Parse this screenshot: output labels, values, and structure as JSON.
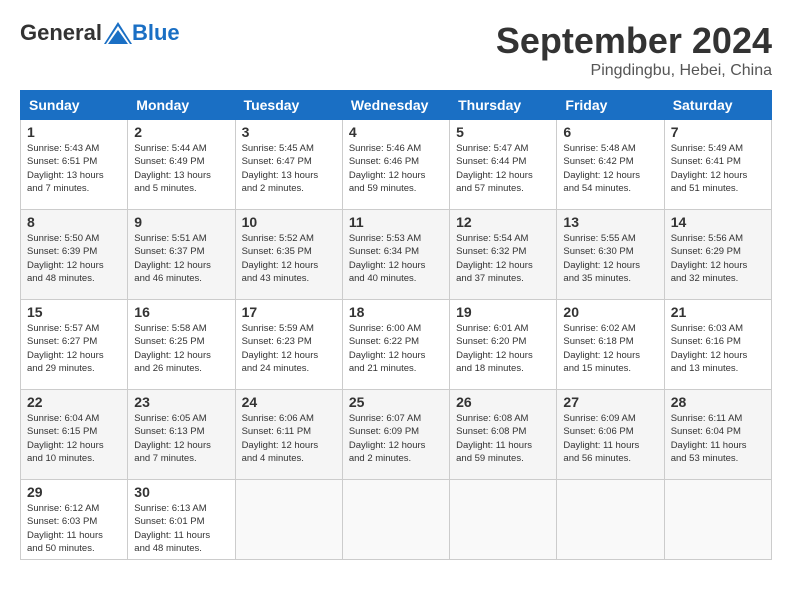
{
  "header": {
    "logo_general": "General",
    "logo_blue": "Blue",
    "month_title": "September 2024",
    "location": "Pingdingbu, Hebei, China"
  },
  "weekdays": [
    "Sunday",
    "Monday",
    "Tuesday",
    "Wednesday",
    "Thursday",
    "Friday",
    "Saturday"
  ],
  "weeks": [
    [
      {
        "day": "1",
        "info": "Sunrise: 5:43 AM\nSunset: 6:51 PM\nDaylight: 13 hours\nand 7 minutes."
      },
      {
        "day": "2",
        "info": "Sunrise: 5:44 AM\nSunset: 6:49 PM\nDaylight: 13 hours\nand 5 minutes."
      },
      {
        "day": "3",
        "info": "Sunrise: 5:45 AM\nSunset: 6:47 PM\nDaylight: 13 hours\nand 2 minutes."
      },
      {
        "day": "4",
        "info": "Sunrise: 5:46 AM\nSunset: 6:46 PM\nDaylight: 12 hours\nand 59 minutes."
      },
      {
        "day": "5",
        "info": "Sunrise: 5:47 AM\nSunset: 6:44 PM\nDaylight: 12 hours\nand 57 minutes."
      },
      {
        "day": "6",
        "info": "Sunrise: 5:48 AM\nSunset: 6:42 PM\nDaylight: 12 hours\nand 54 minutes."
      },
      {
        "day": "7",
        "info": "Sunrise: 5:49 AM\nSunset: 6:41 PM\nDaylight: 12 hours\nand 51 minutes."
      }
    ],
    [
      {
        "day": "8",
        "info": "Sunrise: 5:50 AM\nSunset: 6:39 PM\nDaylight: 12 hours\nand 48 minutes."
      },
      {
        "day": "9",
        "info": "Sunrise: 5:51 AM\nSunset: 6:37 PM\nDaylight: 12 hours\nand 46 minutes."
      },
      {
        "day": "10",
        "info": "Sunrise: 5:52 AM\nSunset: 6:35 PM\nDaylight: 12 hours\nand 43 minutes."
      },
      {
        "day": "11",
        "info": "Sunrise: 5:53 AM\nSunset: 6:34 PM\nDaylight: 12 hours\nand 40 minutes."
      },
      {
        "day": "12",
        "info": "Sunrise: 5:54 AM\nSunset: 6:32 PM\nDaylight: 12 hours\nand 37 minutes."
      },
      {
        "day": "13",
        "info": "Sunrise: 5:55 AM\nSunset: 6:30 PM\nDaylight: 12 hours\nand 35 minutes."
      },
      {
        "day": "14",
        "info": "Sunrise: 5:56 AM\nSunset: 6:29 PM\nDaylight: 12 hours\nand 32 minutes."
      }
    ],
    [
      {
        "day": "15",
        "info": "Sunrise: 5:57 AM\nSunset: 6:27 PM\nDaylight: 12 hours\nand 29 minutes."
      },
      {
        "day": "16",
        "info": "Sunrise: 5:58 AM\nSunset: 6:25 PM\nDaylight: 12 hours\nand 26 minutes."
      },
      {
        "day": "17",
        "info": "Sunrise: 5:59 AM\nSunset: 6:23 PM\nDaylight: 12 hours\nand 24 minutes."
      },
      {
        "day": "18",
        "info": "Sunrise: 6:00 AM\nSunset: 6:22 PM\nDaylight: 12 hours\nand 21 minutes."
      },
      {
        "day": "19",
        "info": "Sunrise: 6:01 AM\nSunset: 6:20 PM\nDaylight: 12 hours\nand 18 minutes."
      },
      {
        "day": "20",
        "info": "Sunrise: 6:02 AM\nSunset: 6:18 PM\nDaylight: 12 hours\nand 15 minutes."
      },
      {
        "day": "21",
        "info": "Sunrise: 6:03 AM\nSunset: 6:16 PM\nDaylight: 12 hours\nand 13 minutes."
      }
    ],
    [
      {
        "day": "22",
        "info": "Sunrise: 6:04 AM\nSunset: 6:15 PM\nDaylight: 12 hours\nand 10 minutes."
      },
      {
        "day": "23",
        "info": "Sunrise: 6:05 AM\nSunset: 6:13 PM\nDaylight: 12 hours\nand 7 minutes."
      },
      {
        "day": "24",
        "info": "Sunrise: 6:06 AM\nSunset: 6:11 PM\nDaylight: 12 hours\nand 4 minutes."
      },
      {
        "day": "25",
        "info": "Sunrise: 6:07 AM\nSunset: 6:09 PM\nDaylight: 12 hours\nand 2 minutes."
      },
      {
        "day": "26",
        "info": "Sunrise: 6:08 AM\nSunset: 6:08 PM\nDaylight: 11 hours\nand 59 minutes."
      },
      {
        "day": "27",
        "info": "Sunrise: 6:09 AM\nSunset: 6:06 PM\nDaylight: 11 hours\nand 56 minutes."
      },
      {
        "day": "28",
        "info": "Sunrise: 6:11 AM\nSunset: 6:04 PM\nDaylight: 11 hours\nand 53 minutes."
      }
    ],
    [
      {
        "day": "29",
        "info": "Sunrise: 6:12 AM\nSunset: 6:03 PM\nDaylight: 11 hours\nand 50 minutes."
      },
      {
        "day": "30",
        "info": "Sunrise: 6:13 AM\nSunset: 6:01 PM\nDaylight: 11 hours\nand 48 minutes."
      },
      {
        "day": "",
        "info": ""
      },
      {
        "day": "",
        "info": ""
      },
      {
        "day": "",
        "info": ""
      },
      {
        "day": "",
        "info": ""
      },
      {
        "day": "",
        "info": ""
      }
    ]
  ]
}
